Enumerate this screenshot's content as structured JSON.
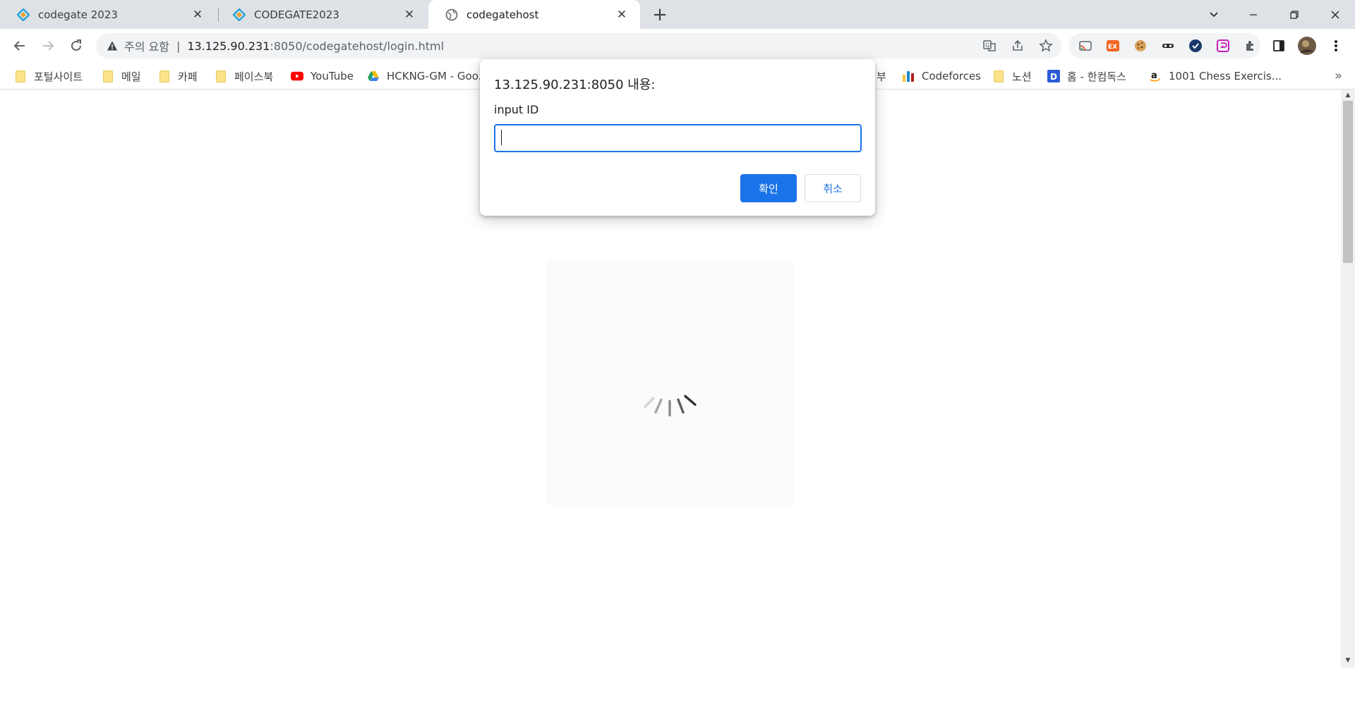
{
  "tabs": [
    {
      "title": "codegate 2023"
    },
    {
      "title": "CODEGATE2023"
    },
    {
      "title": "codegatehost"
    }
  ],
  "window_controls": {
    "minimize": "—",
    "restore": "❐",
    "close": "✕",
    "tab_search": "⌄"
  },
  "address": {
    "status": "주의 요함",
    "separator": "|",
    "host": "13.125.90.231",
    "path": ":8050/codegatehost/login.html"
  },
  "bookmarks": [
    {
      "label": "포털사이트",
      "icon": "folder-icon"
    },
    {
      "label": "메일",
      "icon": "folder-icon"
    },
    {
      "label": "카페",
      "icon": "folder-icon"
    },
    {
      "label": "페이스북",
      "icon": "folder-icon"
    },
    {
      "label": "YouTube",
      "icon": "youtube-icon"
    },
    {
      "label": "HCKNG-GM - Goo...",
      "icon": "google-drive-icon"
    },
    {
      "label": "부",
      "icon": "none"
    },
    {
      "label": "Codeforces",
      "icon": "codeforces-icon"
    },
    {
      "label": "노션",
      "icon": "folder-icon"
    },
    {
      "label": "홈 - 한컴독스",
      "icon": "hancom-docs-icon"
    },
    {
      "label": "1001 Chess Exercis...",
      "icon": "amazon-icon"
    }
  ],
  "bookmarks_overflow": "»",
  "dialog": {
    "title": "13.125.90.231:8050 내용:",
    "message": "input ID",
    "input_value": "",
    "ok_label": "확인",
    "cancel_label": "취소"
  },
  "colors": {
    "accent": "#1a73e8",
    "tabstrip": "#dee1e6",
    "omnibox": "#f1f3f4"
  }
}
